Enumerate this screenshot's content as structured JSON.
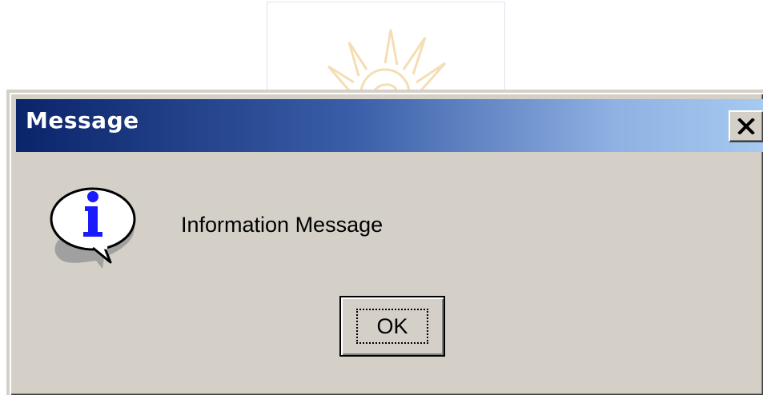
{
  "dialog": {
    "title": "Message",
    "close_label": "X",
    "message": "Information Message",
    "ok_label": "OK"
  },
  "icons": {
    "close": "close-icon",
    "info": "information-icon",
    "background_logo": "sun-logo"
  },
  "colors": {
    "titlebar_start": "#0a246a",
    "titlebar_end": "#a6caf0",
    "dialog_face": "#d4d0c8",
    "info_letter": "#1a1aff"
  }
}
